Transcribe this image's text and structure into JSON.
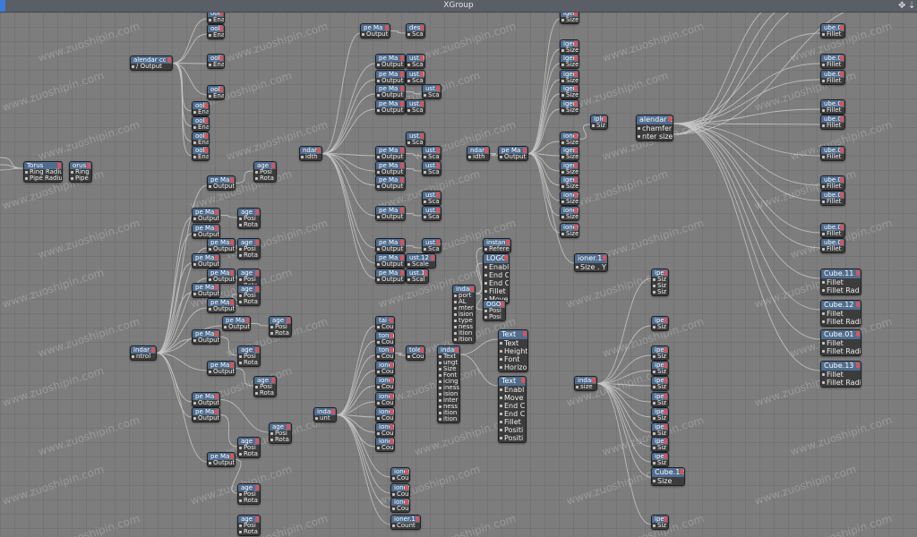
{
  "window": {
    "title": "XGroup",
    "controls": [
      "✥",
      "⇣"
    ]
  },
  "colors": {
    "canvas": "#7d7d7d",
    "header": "#4f6d8f",
    "wire": "#c8c8c8",
    "node_body": "#3c3c3c"
  },
  "watermark": "www.zuoshipin.com",
  "nodes": [
    {
      "id": "torus-a",
      "title": "Torus",
      "ports": [
        "Ring Radius",
        "Pipe Radius"
      ]
    },
    {
      "id": "torus-b",
      "title": "orus.",
      "ports": [
        "Ring",
        "Pipe"
      ]
    },
    {
      "id": "calendar-a",
      "title": "alendar cc",
      "ports": [
        "/ Output"
      ]
    },
    {
      "id": "goli-1",
      "title": "ooli",
      "ports": [
        "Ena"
      ]
    },
    {
      "id": "goli-2",
      "title": "ooli",
      "ports": [
        "Ena"
      ]
    },
    {
      "id": "goli-3",
      "title": "ooli",
      "ports": [
        "Ena"
      ]
    },
    {
      "id": "goli-4",
      "title": "ooli",
      "ports": [
        "Ena"
      ]
    },
    {
      "id": "goli-5",
      "title": "ooli",
      "ports": [
        "Ena"
      ]
    },
    {
      "id": "goli-6",
      "title": "ooli",
      "ports": [
        "Ena"
      ]
    },
    {
      "id": "goli-7",
      "title": "ooli",
      "ports": [
        "Ena"
      ]
    },
    {
      "id": "goli-8",
      "title": "ooli",
      "ports": [
        "Ena"
      ]
    },
    {
      "id": "stand-a",
      "title": "indar",
      "ports": [
        "ntrol"
      ]
    },
    {
      "id": "pm-01",
      "title": "pe Ma",
      "ports": [
        "Output"
      ]
    },
    {
      "id": "pm-02",
      "title": "pe Ma",
      "ports": [
        "Output"
      ]
    },
    {
      "id": "pm-03",
      "title": "pe Ma",
      "ports": [
        "Output"
      ]
    },
    {
      "id": "pm-04",
      "title": "pe Ma",
      "ports": [
        "Output"
      ]
    },
    {
      "id": "pm-05",
      "title": "pe Ma",
      "ports": [
        "Output"
      ]
    },
    {
      "id": "pm-06",
      "title": "pe Ma",
      "ports": [
        "Output"
      ]
    },
    {
      "id": "pm-07",
      "title": "pe Ma",
      "ports": [
        "Output"
      ]
    },
    {
      "id": "pm-08",
      "title": "pe Ma",
      "ports": [
        "Output"
      ]
    },
    {
      "id": "pm-09",
      "title": "pe Ma",
      "ports": [
        "Output"
      ]
    },
    {
      "id": "pm-10",
      "title": "pe Ma",
      "ports": [
        "Output"
      ]
    },
    {
      "id": "pm-11",
      "title": "pe Ma",
      "ports": [
        "Output"
      ]
    },
    {
      "id": "pm-12",
      "title": "pe Ma",
      "ports": [
        "Output"
      ]
    },
    {
      "id": "pm-13",
      "title": "pe Ma",
      "ports": [
        "Output"
      ]
    },
    {
      "id": "pm-14",
      "title": "pe Ma",
      "ports": [
        "Output"
      ]
    },
    {
      "id": "img-01",
      "title": "age",
      "ports": [
        "Posi",
        "Rota"
      ]
    },
    {
      "id": "img-02",
      "title": "age",
      "ports": [
        "Posi",
        "Rota"
      ]
    },
    {
      "id": "img-03",
      "title": "age",
      "ports": [
        "Posi",
        "Rota"
      ]
    },
    {
      "id": "img-04",
      "title": "age",
      "ports": [
        "Posi",
        "Rota"
      ]
    },
    {
      "id": "img-05",
      "title": "age",
      "ports": [
        "Posi",
        "Rota"
      ]
    },
    {
      "id": "img-06",
      "title": "age",
      "ports": [
        "Posi",
        "Rota"
      ]
    },
    {
      "id": "img-07",
      "title": "age",
      "ports": [
        "Posi",
        "Rota"
      ]
    },
    {
      "id": "img-08",
      "title": "age",
      "ports": [
        "Posi",
        "Rota"
      ]
    },
    {
      "id": "img-09",
      "title": "age",
      "ports": [
        "Posi",
        "Rota"
      ]
    },
    {
      "id": "img-10",
      "title": "age",
      "ports": [
        "Posi",
        "Rota"
      ]
    },
    {
      "id": "img-11",
      "title": "age",
      "ports": [
        "Posi",
        "Rota"
      ]
    },
    {
      "id": "img-12",
      "title": "age",
      "ports": [
        "Posi",
        "Rota"
      ]
    },
    {
      "id": "stand-b",
      "title": "ndar",
      "ports": [
        "idth"
      ]
    },
    {
      "id": "pm2-01",
      "title": "pe Ma",
      "ports": [
        "Output"
      ]
    },
    {
      "id": "pm2-02",
      "title": "pe Ma",
      "ports": [
        "Output"
      ]
    },
    {
      "id": "pm2-03",
      "title": "pe Ma",
      "ports": [
        "Output"
      ]
    },
    {
      "id": "pm2-04",
      "title": "pe Ma",
      "ports": [
        "Output"
      ]
    },
    {
      "id": "pm2-05",
      "title": "pe Ma",
      "ports": [
        "Output"
      ]
    },
    {
      "id": "pm2-06",
      "title": "pe Ma",
      "ports": [
        "Output"
      ]
    },
    {
      "id": "pm2-07",
      "title": "pe Ma",
      "ports": [
        "Output"
      ]
    },
    {
      "id": "pm2-08",
      "title": "pe Ma",
      "ports": [
        "Output"
      ]
    },
    {
      "id": "pm2-09",
      "title": "pe Ma",
      "ports": [
        "Output"
      ]
    },
    {
      "id": "pm2-10",
      "title": "pe Ma",
      "ports": [
        "Output"
      ]
    },
    {
      "id": "pm2-11",
      "title": "pe Ma",
      "ports": [
        "Output"
      ]
    },
    {
      "id": "pm2-12",
      "title": "pe Ma",
      "ports": [
        "Output"
      ]
    },
    {
      "id": "dest",
      "title": "dest",
      "ports": [
        "Sca"
      ]
    },
    {
      "id": "ust-01",
      "title": "ust.3",
      "ports": [
        "Sca"
      ]
    },
    {
      "id": "ust-02",
      "title": "ust.3",
      "ports": [
        "Sca"
      ]
    },
    {
      "id": "ust-03",
      "title": "ust.",
      "ports": [
        "Sca"
      ]
    },
    {
      "id": "ust-04",
      "title": "ust.",
      "ports": [
        "Sca"
      ]
    },
    {
      "id": "ust-05",
      "title": "ust.",
      "ports": [
        "Sca"
      ]
    },
    {
      "id": "ust-06",
      "title": "ust.",
      "ports": [
        "Sca"
      ]
    },
    {
      "id": "ust-07",
      "title": "ust.",
      "ports": [
        "Sca"
      ]
    },
    {
      "id": "ust-08",
      "title": "ust.",
      "ports": [
        "Sca"
      ]
    },
    {
      "id": "ust-09",
      "title": "ust.",
      "ports": [
        "Sca"
      ]
    },
    {
      "id": "ust-10",
      "title": "ust.1",
      "ports": [
        "Sca"
      ]
    },
    {
      "id": "ust-11",
      "title": "ust.12",
      "ports": [
        "Scale"
      ]
    },
    {
      "id": "ust-12",
      "title": "ust.1",
      "ports": [
        "Scal"
      ]
    },
    {
      "id": "stand-c",
      "title": "ndar",
      "ports": [
        "idth"
      ]
    },
    {
      "id": "pm3",
      "title": "pe Ma",
      "ports": [
        "Output"
      ]
    },
    {
      "id": "ig-01",
      "title": "iger",
      "ports": [
        "Size"
      ]
    },
    {
      "id": "ig-02",
      "title": "iger",
      "ports": [
        "Size"
      ]
    },
    {
      "id": "ig-03",
      "title": "iger",
      "ports": [
        "Size"
      ]
    },
    {
      "id": "ig-04",
      "title": "iger",
      "ports": [
        "Size"
      ]
    },
    {
      "id": "ig-05",
      "title": "iger",
      "ports": [
        "Size"
      ]
    },
    {
      "id": "ig-06",
      "title": "iger",
      "ports": [
        "Size"
      ]
    },
    {
      "id": "ig-07",
      "title": "ioner",
      "ports": [
        "Size"
      ]
    },
    {
      "id": "ig-08",
      "title": "iger",
      "ports": [
        "Size"
      ]
    },
    {
      "id": "ig-09",
      "title": "iger",
      "ports": [
        "Size"
      ]
    },
    {
      "id": "ig-10",
      "title": "iger",
      "ports": [
        "Size"
      ]
    },
    {
      "id": "ig-11",
      "title": "ioner.1",
      "ports": [
        "Size"
      ]
    },
    {
      "id": "ig-12",
      "title": "ioner.1",
      "ports": [
        "Size"
      ]
    },
    {
      "id": "ig-13",
      "title": "ioner.1",
      "ports": [
        "Size"
      ]
    },
    {
      "id": "ig-14",
      "title": "ioner.1",
      "ports": [
        "Size . Y"
      ]
    },
    {
      "id": "iple",
      "title": "iple",
      "ports": [
        "Siz"
      ]
    },
    {
      "id": "calendar-b",
      "title": "alendar c",
      "ports": [
        "chamfer",
        "nter size"
      ]
    },
    {
      "id": "cube-01",
      "title": "ube.0",
      "ports": [
        "Fillet"
      ]
    },
    {
      "id": "cube-02",
      "title": "ube.0",
      "ports": [
        "Fillet"
      ]
    },
    {
      "id": "cube-03",
      "title": "ube.0",
      "ports": [
        "Fillet"
      ]
    },
    {
      "id": "cube-04",
      "title": "ube.0",
      "ports": [
        "Fillet"
      ]
    },
    {
      "id": "cube-05",
      "title": "ube.0",
      "ports": [
        "Fillet"
      ]
    },
    {
      "id": "cube-06",
      "title": "ube.0",
      "ports": [
        "Fillet"
      ]
    },
    {
      "id": "cube-07",
      "title": "ube.0",
      "ports": [
        "Fillet"
      ]
    },
    {
      "id": "cube-08",
      "title": "ube.0",
      "ports": [
        "Fillet"
      ]
    },
    {
      "id": "cube-09",
      "title": "ube.0",
      "ports": [
        "Fillet"
      ]
    },
    {
      "id": "cube-10",
      "title": "ube.0",
      "ports": [
        "Fillet"
      ]
    },
    {
      "id": "cube-11",
      "title": "Cube.11",
      "ports": [
        "Fillet",
        "Fillet Rad"
      ]
    },
    {
      "id": "cube-12",
      "title": "Cube.12",
      "ports": [
        "Fillet",
        "Fillet Radi"
      ]
    },
    {
      "id": "cube-13",
      "title": "Cube.01",
      "ports": [
        "Fillet",
        "Fillet Radi"
      ]
    },
    {
      "id": "cube-14",
      "title": "Cube.13",
      "ports": [
        "Fillet",
        "Fillet Radi"
      ]
    },
    {
      "id": "stand-d",
      "title": "indar",
      "ports": [
        "unt"
      ]
    },
    {
      "id": "cnt-01",
      "title": "tai C",
      "ports": [
        "Cou"
      ]
    },
    {
      "id": "cnt-02",
      "title": "toner",
      "ports": [
        "Cou"
      ]
    },
    {
      "id": "cnt-03",
      "title": "toner",
      "ports": [
        "Cou"
      ]
    },
    {
      "id": "cnt-04",
      "title": "ioner",
      "ports": [
        "Cou"
      ]
    },
    {
      "id": "cnt-05",
      "title": "ioner",
      "ports": [
        "Cou"
      ]
    },
    {
      "id": "cnt-06",
      "title": "ioner",
      "ports": [
        "Cou"
      ]
    },
    {
      "id": "cnt-07",
      "title": "ioner",
      "ports": [
        "Cou"
      ]
    },
    {
      "id": "cnt-08",
      "title": "ioner",
      "ports": [
        "Cou"
      ]
    },
    {
      "id": "cnt-09",
      "title": "ioner",
      "ports": [
        "Cou"
      ]
    },
    {
      "id": "cnt-10",
      "title": "ioner",
      "ports": [
        "Cou"
      ]
    },
    {
      "id": "cnt-11",
      "title": "ioner",
      "ports": [
        "Cou"
      ]
    },
    {
      "id": "cnt-12",
      "title": "ioner",
      "ports": [
        "Cou"
      ]
    },
    {
      "id": "cnt-13",
      "title": "ioner.1",
      "ports": [
        "Count"
      ]
    },
    {
      "id": "tole",
      "title": "tole",
      "ports": [
        "Cou"
      ]
    },
    {
      "id": "stand-e",
      "title": "indar",
      "ports": [
        "port",
        "AL",
        "mter",
        "ision",
        "type",
        "ness",
        "ition",
        "ition"
      ]
    },
    {
      "id": "instan",
      "title": "instan",
      "ports": [
        "Refere"
      ]
    },
    {
      "id": "logo-a",
      "title": "LOGO",
      "ports": [
        "Enabl",
        "End C",
        "End C",
        "Fillet",
        "Move"
      ]
    },
    {
      "id": "logo-b",
      "title": "OGO",
      "ports": [
        "Posi",
        "Posi"
      ]
    },
    {
      "id": "stand-f",
      "title": "indar",
      "ports": [
        "Text",
        "ungt",
        "Size",
        "Font",
        "icing",
        "iness",
        "ision",
        "inter",
        "ness",
        "ition",
        "ition"
      ]
    },
    {
      "id": "text-a",
      "title": "Text",
      "ports": [
        "Text",
        "Height",
        "Font",
        "Horizor"
      ]
    },
    {
      "id": "text-b",
      "title": "Text",
      "ports": [
        "Enabl",
        "Move",
        "End C",
        "End C",
        "Fillet",
        "Positi",
        "Positi"
      ]
    },
    {
      "id": "stand-g",
      "title": "indar",
      "ports": [
        "size"
      ]
    },
    {
      "id": "sz-01",
      "title": "ipe",
      "ports": [
        "Siz",
        "Siz",
        "Siz"
      ]
    },
    {
      "id": "sz-02",
      "title": "ipe",
      "ports": [
        "Siz"
      ]
    },
    {
      "id": "sz-03",
      "title": "ipe",
      "ports": [
        "Siz"
      ]
    },
    {
      "id": "sz-04",
      "title": "ipe",
      "ports": [
        "Siz"
      ]
    },
    {
      "id": "sz-05",
      "title": "ipe",
      "ports": [
        "Siz"
      ]
    },
    {
      "id": "sz-06",
      "title": "ipe",
      "ports": [
        "Siz"
      ]
    },
    {
      "id": "sz-07",
      "title": "ipe",
      "ports": [
        "Siz"
      ]
    },
    {
      "id": "sz-08",
      "title": "ipe",
      "ports": [
        "Siz"
      ]
    },
    {
      "id": "sz-09",
      "title": "ipe",
      "ports": [
        "Siz"
      ]
    },
    {
      "id": "sz-10",
      "title": "ipe",
      "ports": [
        "Siz"
      ]
    },
    {
      "id": "sz-11",
      "title": "ipe",
      "ports": [
        "Siz"
      ]
    },
    {
      "id": "sz-12",
      "title": "Cube.12",
      "ports": [
        "Size"
      ]
    },
    {
      "id": "sz-13",
      "title": "ipe",
      "ports": [
        "Siz"
      ]
    }
  ]
}
